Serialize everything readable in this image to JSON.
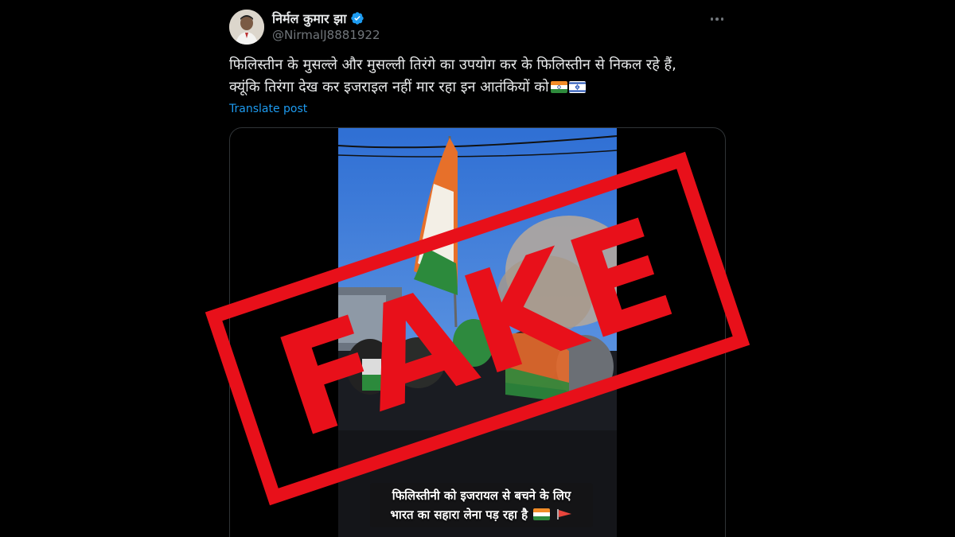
{
  "post": {
    "display_name": "निर्मल कुमार झा",
    "handle": "@NirmalJ8881922",
    "text_line1": "फिलिस्तीन के मुसल्ले और मुसल्ली तिरंगे का उपयोग कर के फिलिस्तीन से निकल रहे हैं,",
    "text_line2": "क्यूंकि तिरंगा देख कर इजराइल नहीं मार रहा इन आतंकियों को",
    "translate_label": "Translate post"
  },
  "media": {
    "caption_line1": "फिलिस्तीनी को इजरायल से बचने के लिए",
    "caption_line2": "भारत का सहारा लेना पड़ रहा है"
  },
  "stamp": {
    "label": "FAKE",
    "color": "#e8101a"
  },
  "icons": {
    "verified": "verified-badge-icon",
    "more": "more-options-icon",
    "flags": [
      "india-flag-icon",
      "israel-flag-icon"
    ]
  },
  "colors": {
    "accent": "#1d9bf0",
    "muted": "#71767b",
    "text": "#e7e9ea",
    "border": "#2f3336"
  }
}
